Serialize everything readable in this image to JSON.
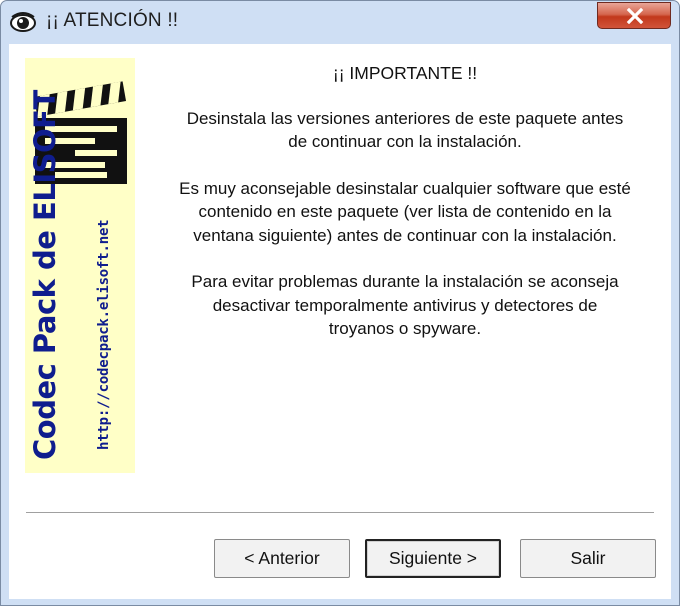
{
  "window": {
    "title": "¡¡ ATENCIÓN !!"
  },
  "banner": {
    "main_text": "Codec Pack de ELISOFT",
    "url_text": "http://codecpack.elisoft.net"
  },
  "content": {
    "heading": "¡¡ IMPORTANTE !!",
    "paragraphs": [
      [
        "Desinstala las versiones anteriores de este paquete antes",
        "de continuar con la instalación."
      ],
      [
        "Es muy aconsejable desinstalar cualquier software que esté",
        "contenido en este paquete (ver lista de contenido en la",
        "ventana siguiente) antes de continuar con la instalación."
      ],
      [
        "Para evitar problemas durante la instalación se aconseja",
        "desactivar temporalmente antivirus y detectores de",
        "troyanos o spyware."
      ]
    ]
  },
  "buttons": {
    "prev": "< Anterior",
    "next": "Siguiente >",
    "exit": "Salir"
  },
  "icons": {
    "app": "eye-icon",
    "close": "close-icon"
  },
  "colors": {
    "frame": "#cfdff4",
    "banner_bg": "#ffffc7",
    "banner_text": "#0f1d8e",
    "close_red": "#c2381c"
  }
}
